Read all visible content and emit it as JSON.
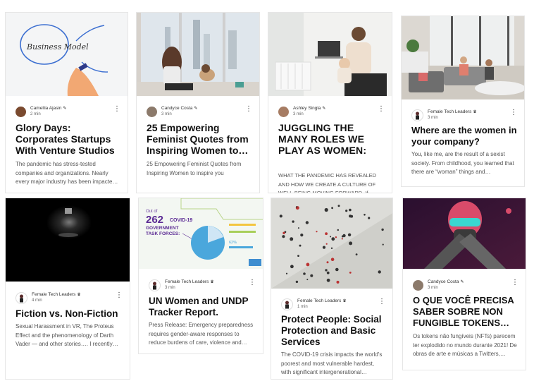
{
  "cards": [
    {
      "author": "Camellia Ajasin",
      "badge": "✎",
      "time": "2 min",
      "title": "Glory Days: Corporates Startups With Venture Studios",
      "excerpt": "The pandemic has stress-tested companies and organizations. Nearly every major industry has been impacte…"
    },
    {
      "author": "Candyce Costa",
      "badge": "✎",
      "time": "3 min",
      "title": "25 Empowering Feminist Quotes from Inspiring Women to…",
      "excerpt": "25 Empowering Feminist Quotes from Inspiring Women to inspire you"
    },
    {
      "author": "Ashley Singla",
      "badge": "✎",
      "time": "3 min",
      "title": "JUGGLING THE MANY ROLES WE PLAY AS WOMEN:",
      "excerpt": "WHAT THE PANDEMIC HAS REVEALED AND HOW WE CREATE A CULTURE OF WELL-BEING MOVING FORWARD. If…"
    },
    {
      "author": "Female Tech Leaders",
      "badge": "♛",
      "time": "3 min",
      "title": "Where are the women in your company?",
      "excerpt": "You, like me, are the result of a sexist society. From childhood, you learned that there are “woman” things and…"
    },
    {
      "author": "Female Tech Leaders",
      "badge": "♛",
      "time": "4 min",
      "title": "Fiction vs. Non-Fiction",
      "excerpt": "Sexual Harassment in VR, The Proteus Effect and the phenomenology of Darth Vader — and other stories…. I recently…"
    },
    {
      "author": "Female Tech Leaders",
      "badge": "♛",
      "time": "3 min",
      "title": "UN Women and UNDP Tracker Report.",
      "excerpt": "Press Release: Emergency preparedness requires gender-aware responses to reduce burdens of care, violence and…"
    },
    {
      "author": "Female Tech Leaders",
      "badge": "♛",
      "time": "1 min",
      "title": "Protect People: Social Protection and Basic Services",
      "excerpt": "The COVID-19 crisis impacts the world's poorest and most vulnerable hardest, with significant intergenerational…"
    },
    {
      "author": "Candyce Costa",
      "badge": "✎",
      "time": "3 min",
      "title": "O QUE VOCÊ PRECISA SABER SOBRE NON FUNGIBLE TOKENS…",
      "excerpt": "Os tokens não fungíveis (NFTs) parecem ter explodido no mundo durante 2021! De obras de arte e músicas a Twitters,…"
    }
  ],
  "thumb_text": {
    "whiteboard": "Business Model",
    "infographic_out_of": "Out of",
    "infographic_number": "262",
    "infographic_line1": "COVID-19",
    "infographic_line2": "GOVERNMENT",
    "infographic_line3": "TASK FORCES:",
    "infographic_pct1": "62%"
  },
  "more_glyph": "⋮"
}
